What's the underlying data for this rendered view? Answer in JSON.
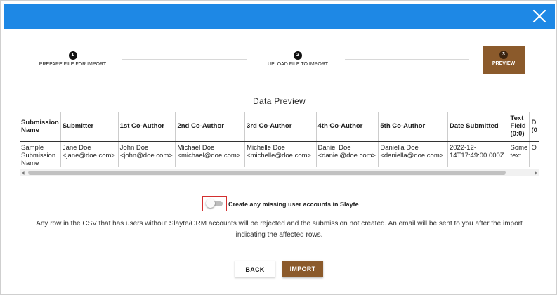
{
  "dialog": {
    "header_color": "#1e88e5",
    "accent_color": "#8b5a2b",
    "close_icon": "close-icon"
  },
  "stepper": {
    "steps": [
      {
        "number": "1",
        "label": "PREPARE FILE FOR IMPORT"
      },
      {
        "number": "2",
        "label": "UPLOAD FILE TO IMPORT"
      },
      {
        "number": "3",
        "label": "PREVIEW"
      }
    ]
  },
  "preview": {
    "title": "Data Preview",
    "columns": [
      "Submission Name",
      "Submitter",
      "1st Co-Author",
      "2nd Co-Author",
      "3rd Co-Author",
      "4th Co-Author",
      "5th Co-Author",
      "Date Submitted",
      "Text Field (0:0)",
      "D (0"
    ],
    "rows": [
      {
        "submission_name": "Sample Submission Name",
        "submitter_name": "Jane Doe",
        "submitter_email": "<jane@doe.com>",
        "co1_name": "John Doe",
        "co1_email": "<john@doe.com>",
        "co2_name": "Michael Doe",
        "co2_email": "<michael@doe.com>",
        "co3_name": "Michelle Doe",
        "co3_email": "<michelle@doe.com>",
        "co4_name": "Daniel Doe",
        "co4_email": "<daniel@doe.com>",
        "co5_name": "Daniella Doe",
        "co5_email": "<daniella@doe.com>",
        "date_line1": "2022-12-",
        "date_line2": "14T17:49:00.000Z",
        "text_line1": "Some",
        "text_line2": "text",
        "extra": "O"
      }
    ]
  },
  "options": {
    "create_accounts_label": "Create any missing user accounts in Slayte",
    "create_accounts_enabled": false
  },
  "note": "Any row in the CSV that has users without Slayte/CRM accounts will be rejected and the submission not created. An email will be sent to you after the import indicating the affected rows.",
  "actions": {
    "back_label": "BACK",
    "import_label": "IMPORT"
  }
}
